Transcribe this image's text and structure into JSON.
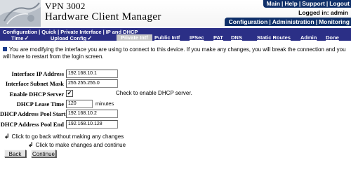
{
  "header": {
    "product_line1": "VPN 3002",
    "product_line2": "Hardware Client Manager",
    "top_links": [
      "Main",
      "Help",
      "Support",
      "Logout"
    ],
    "logged_in": "Logged in: admin",
    "main_nav": [
      "Configuration",
      "Administration",
      "Monitoring"
    ]
  },
  "progress": {
    "breadcrumb": [
      "Configuration",
      "Quick",
      "Private Interface",
      "IP and DHCP"
    ],
    "steps": [
      {
        "label": "Time",
        "state": "done"
      },
      {
        "label": "Upload Config",
        "state": "done"
      },
      {
        "label": "Private Intf",
        "state": "current"
      },
      {
        "label": "Public Intf",
        "state": "todo"
      },
      {
        "label": "IPSec",
        "state": "todo"
      },
      {
        "label": "PAT",
        "state": "todo"
      },
      {
        "label": "DNS",
        "state": "todo"
      },
      {
        "label": "Static Routes",
        "state": "todo"
      },
      {
        "label": "Admin",
        "state": "todo"
      },
      {
        "label": "Done",
        "state": "todo"
      }
    ],
    "check_glyph": "✓"
  },
  "notice": "You are modifying the interface you are using to connect to this device. If you make any changes, you will break the connection and you will have to restart from the login screen.",
  "form": {
    "ip_address": {
      "label": "Interface IP Address",
      "value": "192.168.10.1"
    },
    "subnet_mask": {
      "label": "Interface Subnet Mask",
      "value": "255.255.255.0"
    },
    "dhcp_server": {
      "label": "Enable DHCP Server",
      "checked": true,
      "check_glyph": "✔",
      "help": "Check to enable DHCP server."
    },
    "lease_time": {
      "label": "DHCP Lease Time",
      "value": "120",
      "unit": "minutes"
    },
    "pool_start": {
      "label": "DHCP Address Pool Start",
      "value": "192.168.10.2"
    },
    "pool_end": {
      "label": "DHCP Address Pool End",
      "value": "192.168.10.128"
    }
  },
  "hints": {
    "back": "Click to go back without making any changes",
    "continue": "Click to make changes and continue",
    "arrow_glyph": "↲"
  },
  "buttons": {
    "back": "Back",
    "continue": "Continue"
  },
  "colors": {
    "nav_bg": "#10306a",
    "strip_bg": "#2b2f86",
    "current_step_bg": "#c8c8c8"
  }
}
